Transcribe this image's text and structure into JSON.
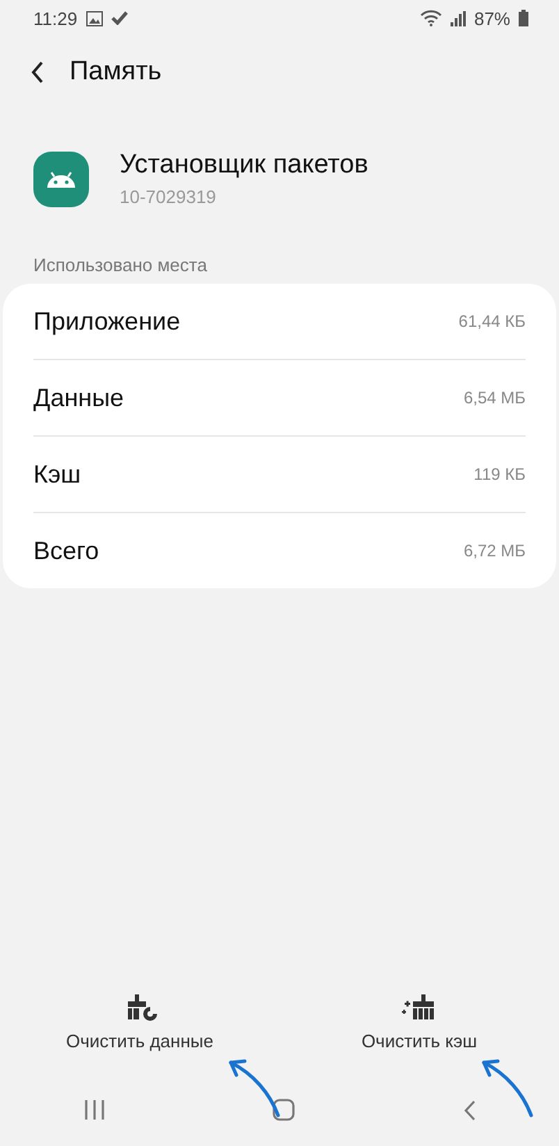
{
  "status_bar": {
    "time": "11:29",
    "battery": "87%"
  },
  "header": {
    "title": "Память"
  },
  "app": {
    "name": "Установщик пакетов",
    "version": "10-7029319"
  },
  "section_label": "Использовано места",
  "storage_rows": [
    {
      "label": "Приложение",
      "value": "61,44 КБ"
    },
    {
      "label": "Данные",
      "value": "6,54 МБ"
    },
    {
      "label": "Кэш",
      "value": "119 КБ"
    },
    {
      "label": "Всего",
      "value": "6,72 МБ"
    }
  ],
  "actions": [
    {
      "kind": "data",
      "label": "Очистить данные"
    },
    {
      "kind": "cache",
      "label": "Очистить кэш"
    }
  ]
}
